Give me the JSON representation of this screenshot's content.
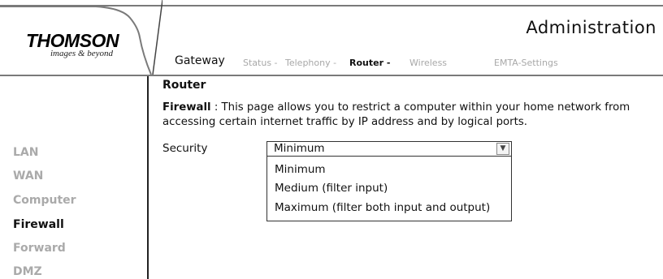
{
  "header": {
    "brand": "THOMSON",
    "tagline": "images & beyond",
    "title": "Administration"
  },
  "nav": {
    "current": "Gateway",
    "links": [
      {
        "label": "Status -"
      },
      {
        "label": "Telephony -"
      },
      {
        "label": "Router -"
      },
      {
        "label": "Wireless"
      },
      {
        "label": "EMTA-Settings"
      }
    ]
  },
  "sidebar": {
    "items": [
      {
        "label": "LAN"
      },
      {
        "label": "WAN"
      },
      {
        "label": "Computer"
      },
      {
        "label": "Firewall"
      },
      {
        "label": "Forward"
      },
      {
        "label": "DMZ"
      }
    ]
  },
  "content": {
    "title": "Router",
    "desc_bold": "Firewall",
    "desc_rest": " : This page allows you to restrict a computer within your home network from accessing certain internet traffic by IP address and by logical ports.",
    "security_label": "Security",
    "security_selected": "Minimum",
    "options": [
      "Minimum",
      "Medium (filter input)",
      "Maximum (filter both input and output)"
    ]
  }
}
